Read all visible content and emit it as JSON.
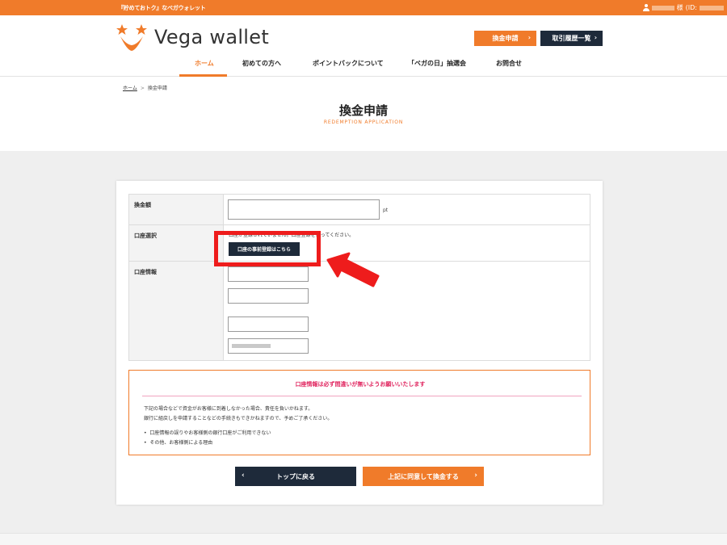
{
  "topbar": {
    "tagline": "『貯めておトク』なベガウォレット",
    "user_suffix": "様",
    "id_label": "(ID:"
  },
  "header": {
    "logo_text": "Vega wallet",
    "apply_button": "換金申請",
    "history_button": "取引履歴一覧",
    "nav": [
      {
        "label": "ホーム",
        "active": true
      },
      {
        "label": "初めての方へ",
        "active": false
      },
      {
        "label": "ポイントバックについて",
        "active": false
      },
      {
        "label": "「ベガの日」抽選会",
        "active": false
      },
      {
        "label": "お問合せ",
        "active": false
      }
    ]
  },
  "breadcrumb": {
    "home": "ホーム",
    "separator": ">",
    "current": "換金申請"
  },
  "page": {
    "title": "換金申請",
    "subtitle": "REDEMPTION APPLICATION"
  },
  "form": {
    "amount_label": "換金額",
    "amount_unit": "pt",
    "account_select_label": "口座選択",
    "account_select_note": "口座が登録されていません。口座登録を行ってください。",
    "register_button": "口座の事前登録はこちら",
    "account_info_label": "口座情報"
  },
  "notice": {
    "title": "口座情報は必ず間違いが無いようお願いいたします",
    "lines": [
      "下記の場合などで資金がお客様に到着しなかった場合、責任を負いかねます。",
      "銀行に組戻しを申請することなどの手続きもできかねますので、予めご了承ください。"
    ],
    "bullets": [
      "口座情報の誤りやお客様側の銀行口座がご利用できない",
      "その他、お客様側による理由"
    ]
  },
  "actions": {
    "back_button": "トップに戻る",
    "agree_button": "上記に同意して換金する"
  },
  "colors": {
    "brand_orange": "#f07b2a",
    "navy": "#1e2a3a",
    "highlight_red": "#ee1c1c",
    "notice_pink": "#e0245e"
  }
}
